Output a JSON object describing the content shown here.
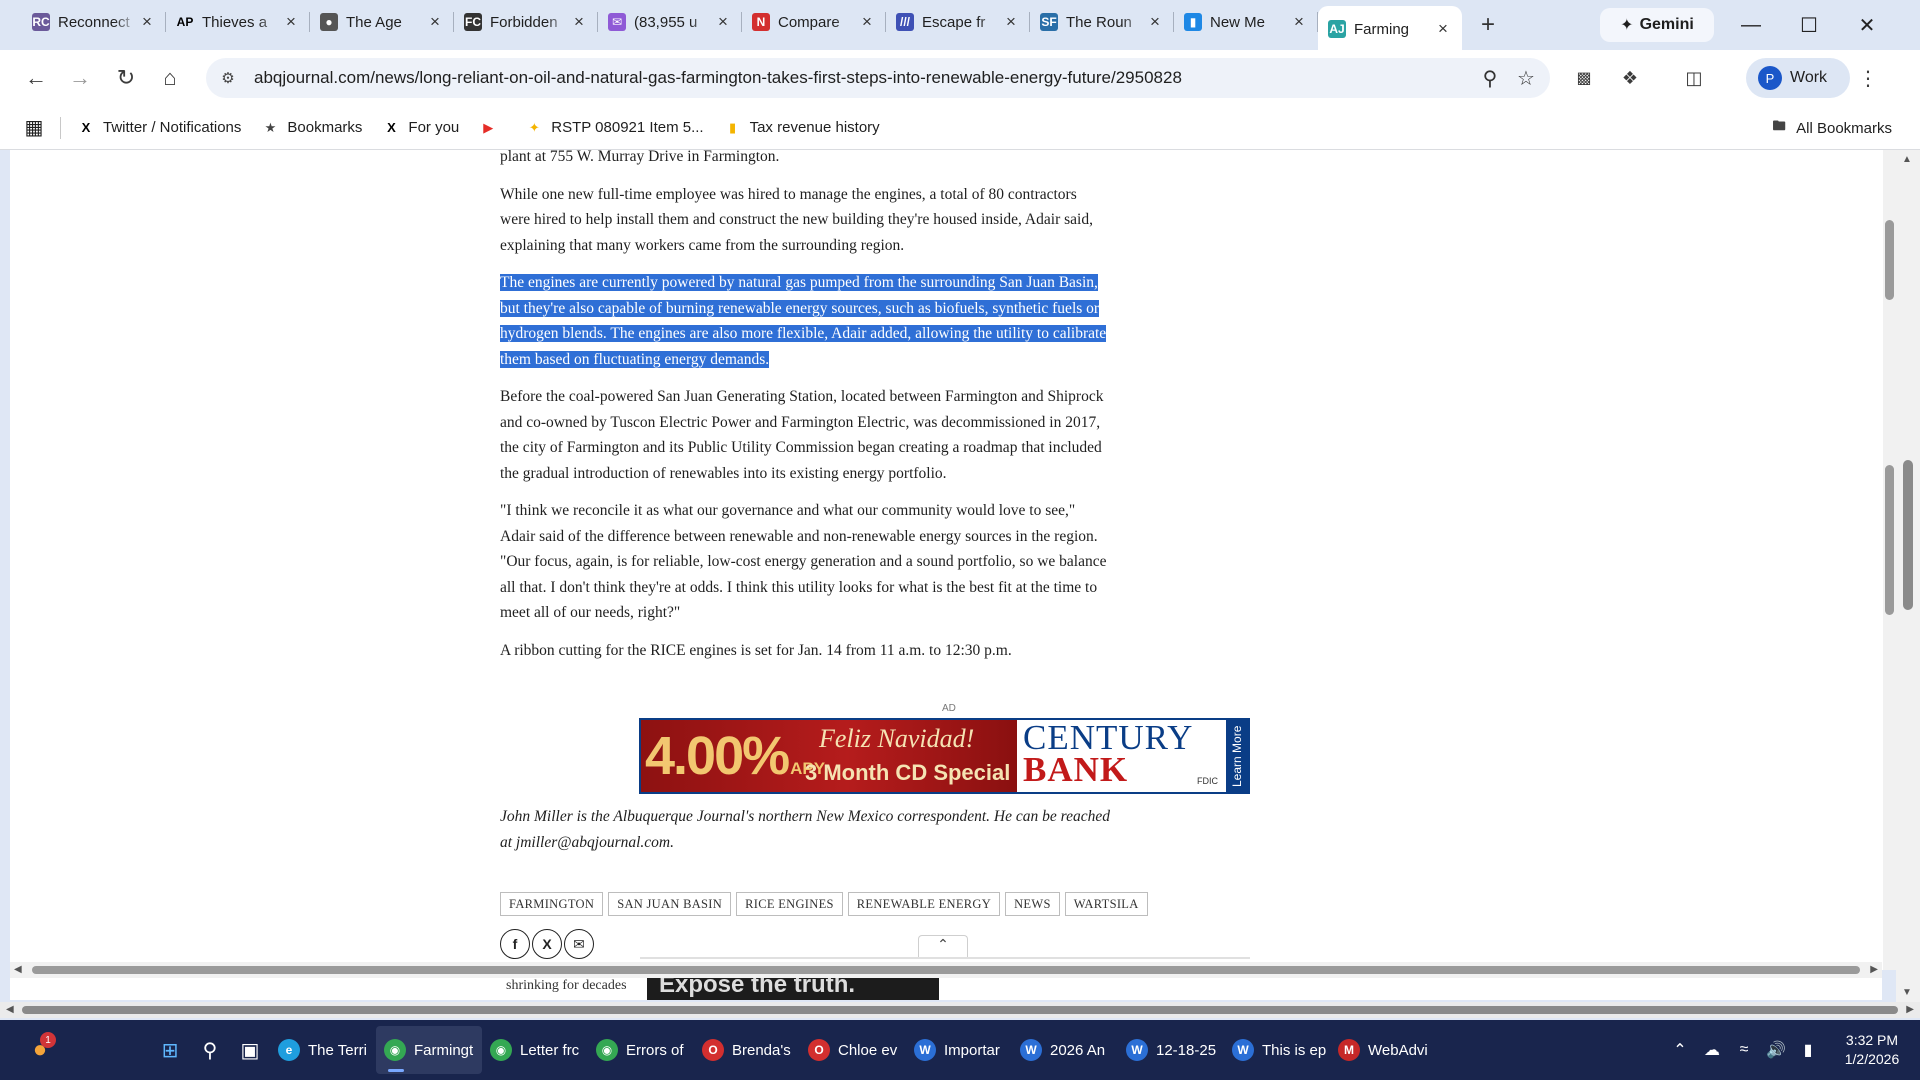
{
  "browser": {
    "tabs": [
      {
        "title": "Reconnect",
        "favicon": "RC",
        "color": "#6b5a9a"
      },
      {
        "title": "Thieves a",
        "favicon": "AP",
        "color": "#ffffff"
      },
      {
        "title": "The Age",
        "favicon": "●",
        "color": "#555555"
      },
      {
        "title": "Forbidden",
        "favicon": "FC",
        "color": "#333333"
      },
      {
        "title": "(83,955 u",
        "favicon": "✉",
        "color": "#8f5ad6"
      },
      {
        "title": "Compare",
        "favicon": "N",
        "color": "#d32f2f"
      },
      {
        "title": "Escape fr",
        "favicon": "///",
        "color": "#3f51b5"
      },
      {
        "title": "The Roun",
        "favicon": "SF",
        "color": "#2a6fa8"
      },
      {
        "title": "New Me",
        "favicon": "▮",
        "color": "#1e88e5"
      },
      {
        "title": "Farming",
        "favicon": "AJ",
        "color": "#2aa3a3",
        "active": true
      }
    ],
    "new_tab_label": "+",
    "gemini_label": "Gemini",
    "url": "abqjournal.com/news/long-reliant-on-oil-and-natural-gas-farmington-takes-first-steps-into-renewable-energy-future/2950828",
    "profile_initial": "P",
    "profile_label": "Work"
  },
  "bookmarks": [
    {
      "label": "Twitter / Notifications",
      "icon": "X",
      "color": "#000000"
    },
    {
      "label": "Bookmarks",
      "icon": "★",
      "color": "#444444"
    },
    {
      "label": "For you",
      "icon": "X",
      "color": "#000000"
    },
    {
      "label": "",
      "icon": "▶",
      "color": "#e52d27"
    },
    {
      "label": "RSTP 080921 Item 5...",
      "icon": "✦",
      "color": "#f4b400"
    },
    {
      "label": "Tax revenue history",
      "icon": "▮",
      "color": "#f4b400"
    }
  ],
  "all_bookmarks_label": "All Bookmarks",
  "article": {
    "lead_fragment": "plant at 755 W. Murray Drive in Farmington.",
    "p1": "While one new full-time employee was hired to manage the engines, a total of 80 contractors were hired to help install them and construct the new building they're housed inside, Adair said, explaining that many workers came from the surrounding region.",
    "p2_highlighted": "The engines are currently powered by natural gas pumped from the surrounding San Juan Basin, but they're also capable of burning renewable energy sources, such as biofuels, synthetic fuels or hydrogen blends. The engines are also more flexible, Adair added, allowing the utility to calibrate them based on fluctuating energy demands.",
    "p3": "Before the coal-powered San Juan Generating Station, located between Farmington and Shiprock and co-owned by Tuscon Electric Power and Farmington Electric, was decommissioned in 2017, the city of Farmington and its Public Utility Commission began creating a roadmap that included the gradual introduction of renewables into its existing energy portfolio.",
    "p4": "\"I think we reconcile it as what our governance and what our community would love to see,\" Adair said of the difference between renewable and non-renewable energy sources in the region. \"Our focus, again, is for reliable, low-cost energy generation and a sound portfolio, so we balance all that. I don't think they're at odds. I think this utility looks for what is the best fit at the time to meet all of our needs, right?\"",
    "p5": "A ribbon cutting for the RICE engines is set for Jan. 14 from 11 a.m. to 12:30 p.m.",
    "author_note": "John Miller is the Albuquerque Journal's northern New Mexico correspondent. He can be reached at jmiller@abqjournal.com.",
    "tags": [
      "FARMINGTON",
      "SAN JUAN BASIN",
      "RICE ENGINES",
      "RENEWABLE ENERGY",
      "NEWS",
      "WARTSILA"
    ],
    "below_fold_text": "shrinking for decades",
    "below_fold_banner": "Expose the truth."
  },
  "ad": {
    "label": "AD",
    "rate": "4.00%",
    "apy": "APY",
    "greeting": "Feliz Navidad!",
    "offer": "3 Month CD Special",
    "brand_line1": "CENTURY",
    "brand_line2": "BANK",
    "learn_more": "Learn More",
    "fdic": "FDIC"
  },
  "taskbar": {
    "notification_count": "1",
    "apps": [
      {
        "label": "The Terri",
        "icon": "e",
        "color": "#1f9ede"
      },
      {
        "label": "Farmingt",
        "icon": "◉",
        "color": "#34a853",
        "active": true
      },
      {
        "label": "Letter frc",
        "icon": "◉",
        "color": "#34a853"
      },
      {
        "label": "Errors of",
        "icon": "◉",
        "color": "#34a853"
      },
      {
        "label": "Brenda's",
        "icon": "O",
        "color": "#d32f2f"
      },
      {
        "label": "Chloe ev",
        "icon": "O",
        "color": "#d32f2f"
      },
      {
        "label": "Importar",
        "icon": "W",
        "color": "#2b6fd6"
      },
      {
        "label": "2026 An",
        "icon": "W",
        "color": "#2b6fd6"
      },
      {
        "label": "12-18-25",
        "icon": "W",
        "color": "#2b6fd6"
      },
      {
        "label": "This is ep",
        "icon": "W",
        "color": "#2b6fd6"
      },
      {
        "label": "WebAdvi",
        "icon": "M",
        "color": "#c62828"
      }
    ],
    "time": "3:32 PM",
    "date": "1/2/2026"
  }
}
